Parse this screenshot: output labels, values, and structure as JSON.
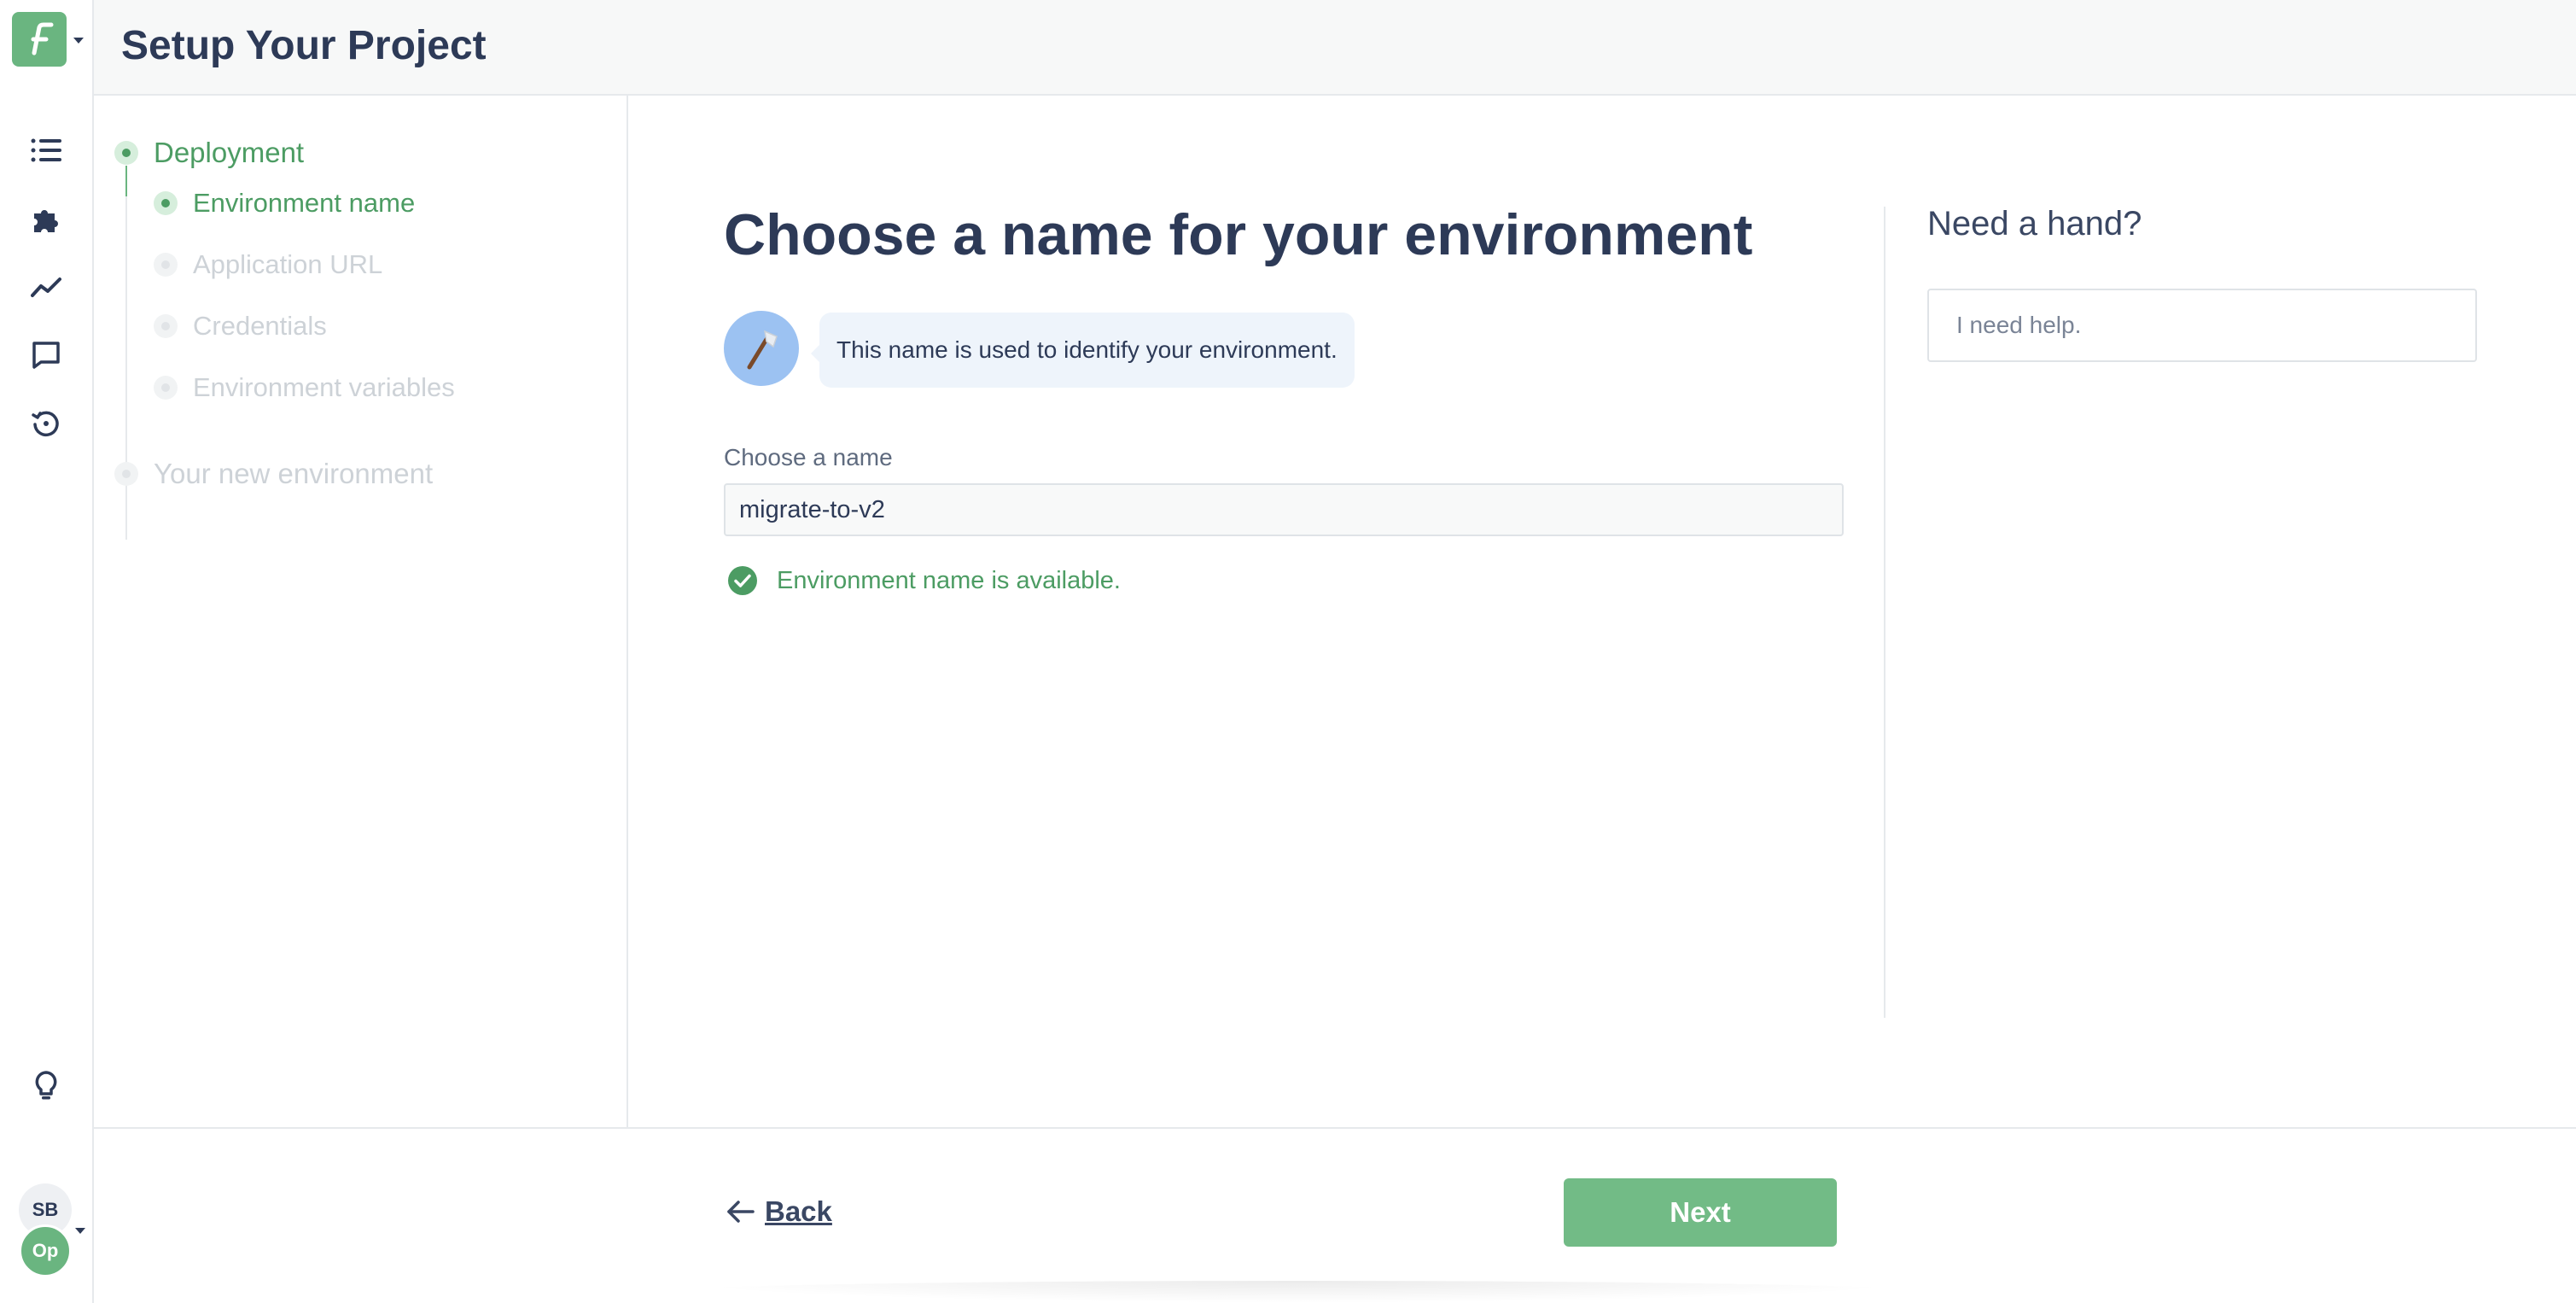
{
  "app": {
    "logo_letter": "F",
    "logo_color": "#6ab580"
  },
  "header": {
    "title": "Setup Your Project"
  },
  "rail": {
    "items": [
      {
        "icon": "list-icon"
      },
      {
        "icon": "puzzle-icon"
      },
      {
        "icon": "chart-line-icon"
      },
      {
        "icon": "chat-icon"
      },
      {
        "icon": "history-icon"
      }
    ],
    "bottom_icon": "lightbulb-icon",
    "user_initials": "SB",
    "project_initials": "Op"
  },
  "steps": {
    "deployment": {
      "label": "Deployment",
      "state": "active"
    },
    "substeps": [
      {
        "label": "Environment name",
        "state": "active"
      },
      {
        "label": "Application URL",
        "state": "inactive"
      },
      {
        "label": "Credentials",
        "state": "inactive"
      },
      {
        "label": "Environment variables",
        "state": "inactive"
      }
    ],
    "final": {
      "label": "Your new environment",
      "state": "inactive"
    }
  },
  "main": {
    "title": "Choose a name for your environment",
    "hint": "This name is used to identify your environment.",
    "hint_icon": "axe-icon",
    "field_label": "Choose a name",
    "field_value": "migrate-to-v2",
    "status_text": "Environment name is available.",
    "status_icon": "check-circle-icon"
  },
  "help": {
    "title": "Need a hand?",
    "placeholder": "I need help."
  },
  "footer": {
    "back_label": "Back",
    "next_label": "Next"
  },
  "colors": {
    "accent": "#6ab580",
    "accent_text": "#4c9c63",
    "text": "#2d3a57"
  }
}
